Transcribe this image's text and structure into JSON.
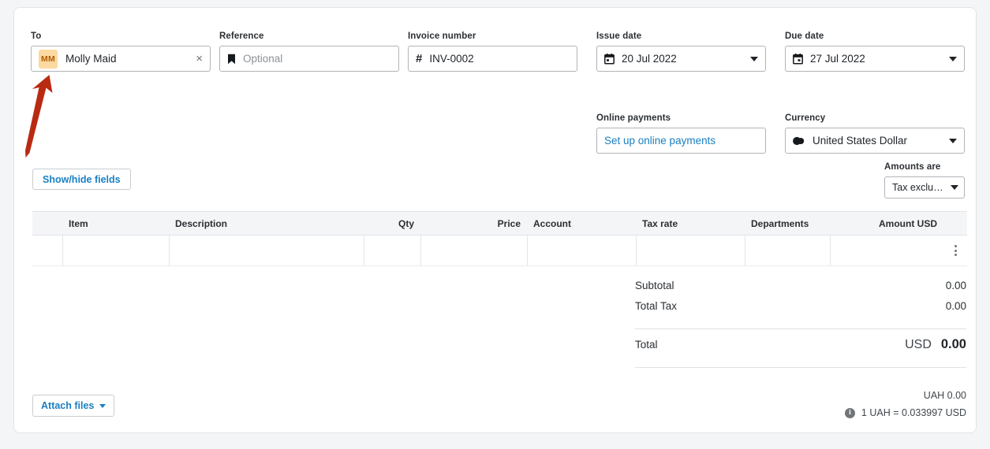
{
  "fields": {
    "to": {
      "label": "To",
      "avatar_initials": "MM",
      "value": "Molly Maid",
      "clear_glyph": "×"
    },
    "reference": {
      "label": "Reference",
      "placeholder": "Optional",
      "value": ""
    },
    "invoice_number": {
      "label": "Invoice number",
      "prefix": "#",
      "value": "INV-0002"
    },
    "issue_date": {
      "label": "Issue date",
      "value": "20 Jul 2022"
    },
    "due_date": {
      "label": "Due date",
      "value": "27 Jul 2022"
    },
    "online_payments": {
      "label": "Online payments",
      "link_text": "Set up online payments"
    },
    "currency": {
      "label": "Currency",
      "value": "United States Dollar"
    },
    "amounts_are": {
      "label": "Amounts are",
      "value": "Tax exclusive"
    }
  },
  "buttons": {
    "show_hide_fields": "Show/hide fields",
    "attach_files": "Attach files"
  },
  "table": {
    "headers": {
      "item": "Item",
      "description": "Description",
      "qty": "Qty",
      "price": "Price",
      "account": "Account",
      "tax_rate": "Tax rate",
      "departments": "Departments",
      "amount": "Amount USD"
    },
    "rows": [
      {
        "item": "",
        "description": "",
        "qty": "",
        "price": "",
        "account": "",
        "tax_rate": "",
        "departments": "",
        "amount": ""
      }
    ]
  },
  "totals": {
    "subtotal_label": "Subtotal",
    "subtotal_value": "0.00",
    "total_tax_label": "Total Tax",
    "total_tax_value": "0.00",
    "total_label": "Total",
    "total_currency": "USD",
    "total_value": "0.00"
  },
  "fx": {
    "secondary_total": "UAH 0.00",
    "rate_text": "1 UAH = 0.033997 USD",
    "info_glyph": "i"
  },
  "colors": {
    "link": "#1a7fc1",
    "avatar_bg": "#fcd9a0",
    "avatar_fg": "#b35a00",
    "arrow": "#b92a12",
    "table_header_bg": "#f4f5f7"
  }
}
